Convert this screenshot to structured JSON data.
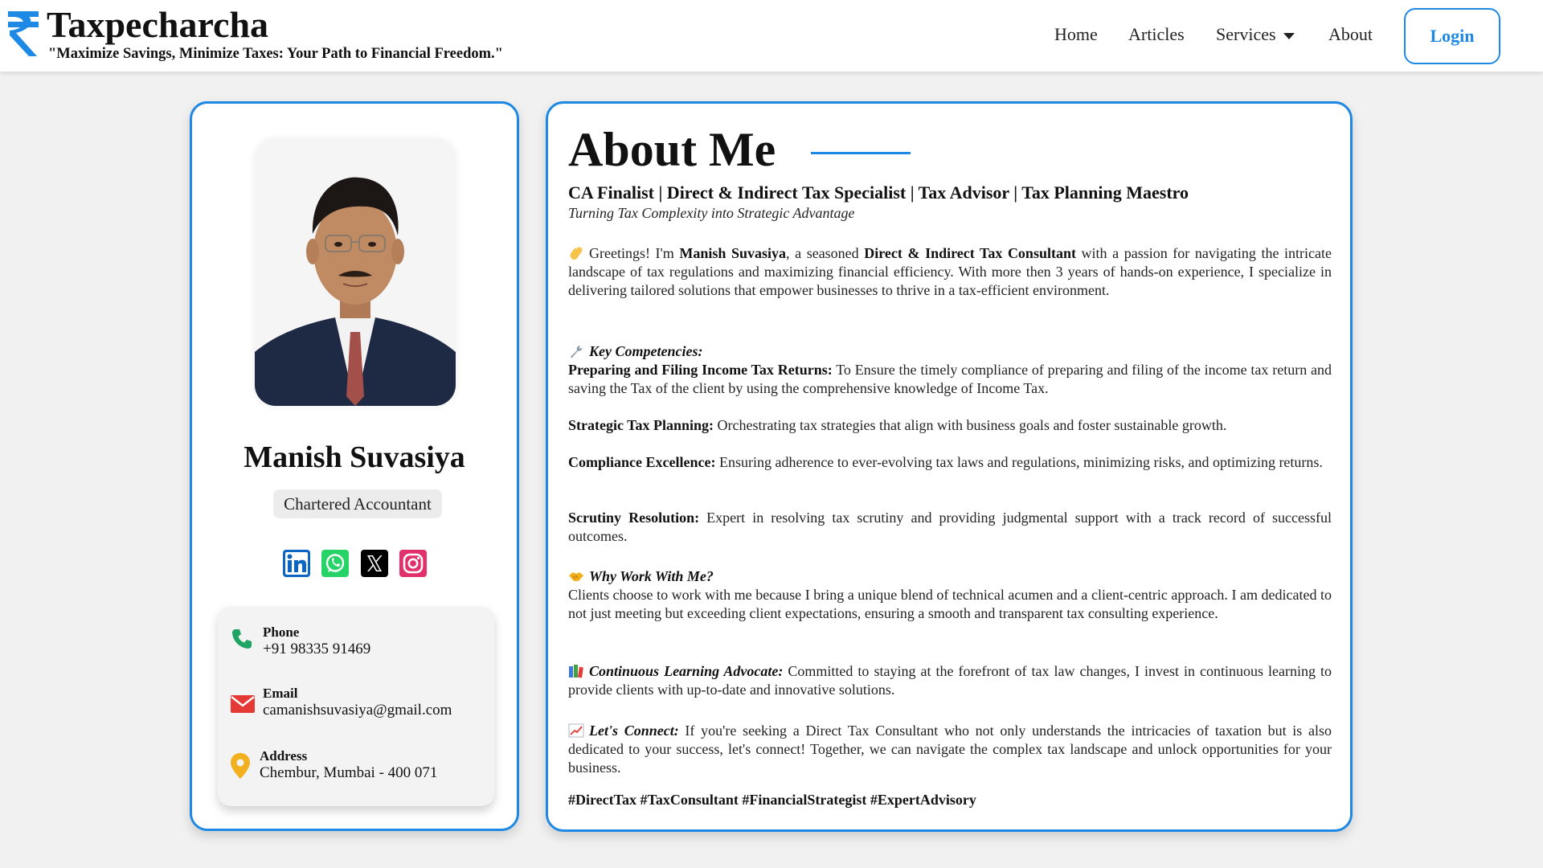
{
  "header": {
    "brand_name": "Taxpecharcha",
    "tagline": "\"Maximize Savings, Minimize Taxes: Your Path to Financial Freedom.\"",
    "nav": {
      "home": "Home",
      "articles": "Articles",
      "services": "Services",
      "about": "About"
    },
    "login_label": "Login",
    "logo_icon": "rupee-icon"
  },
  "profile": {
    "name": "Manish Suvasiya",
    "role": "Chartered Accountant",
    "social_icons": [
      "linkedin-icon",
      "whatsapp-icon",
      "x-icon",
      "instagram-icon"
    ],
    "contact": {
      "phone_label": "Phone",
      "phone_value": "+91 98335 91469",
      "email_label": "Email",
      "email_value": "camanishsuvasiya@gmail.com",
      "address_label": "Address",
      "address_value": "Chembur, Mumbai - 400 071"
    }
  },
  "about": {
    "title": "About Me",
    "headline": "CA Finalist | Direct & Indirect Tax Specialist | Tax Advisor | Tax Planning Maestro",
    "subtitle": "Turning Tax Complexity into Strategic Advantage",
    "intro": {
      "t1": "Greetings! I'm ",
      "name": "Manish Suvasiya",
      "t2": ", a seasoned ",
      "role": "Direct & Indirect Tax Consultant",
      "t3": " with a passion for navigating the intricate landscape of tax regulations and maximizing financial efficiency. With more then 3 years of hands-on experience, I specialize in delivering tailored solutions that empower businesses to thrive in a tax-efficient environment."
    },
    "key_competencies_heading": "Key Competencies:",
    "competencies": [
      {
        "title": "Preparing and Filing Income Tax Returns:",
        "text": " To Ensure the timely compliance of preparing and filing of the income tax return and saving the Tax of the client by using the comprehensive knowledge of Income Tax."
      },
      {
        "title": "Strategic Tax Planning:",
        "text": " Orchestrating tax strategies that align with business goals and foster sustainable growth."
      },
      {
        "title": "Compliance Excellence:",
        "text": " Ensuring adherence to ever-evolving tax laws and regulations, minimizing risks, and optimizing returns."
      },
      {
        "title": "Scrutiny Resolution:",
        "text": " Expert in resolving tax scrutiny and providing judgmental support with a track record of successful outcomes."
      }
    ],
    "why_heading": "Why Work With Me?",
    "why_text": "Clients choose to work with me because I bring a unique blend of technical acumen and a client-centric approach. I am dedicated to not just meeting but exceeding client expectations, ensuring a smooth and transparent tax consulting experience.",
    "learning_heading": "Continuous Learning Advocate:",
    "learning_text": " Committed to staying at the forefront of tax law changes, I invest in continuous learning to provide clients with up-to-date and innovative solutions.",
    "connect_heading": "Let's Connect:",
    "connect_text": " If you're seeking a Direct Tax Consultant who not only understands the intricacies of taxation but is also dedicated to your success, let's connect! Together, we can navigate the complex tax landscape and unlock opportunities for your business.",
    "hashtags": "#DirectTax #TaxConsultant #FinancialStrategist #ExpertAdvisory"
  },
  "colors": {
    "accent": "#1e88e5",
    "phone_icon": "#1fa463",
    "email_icon": "#e53935",
    "address_icon": "#f2b01e"
  }
}
